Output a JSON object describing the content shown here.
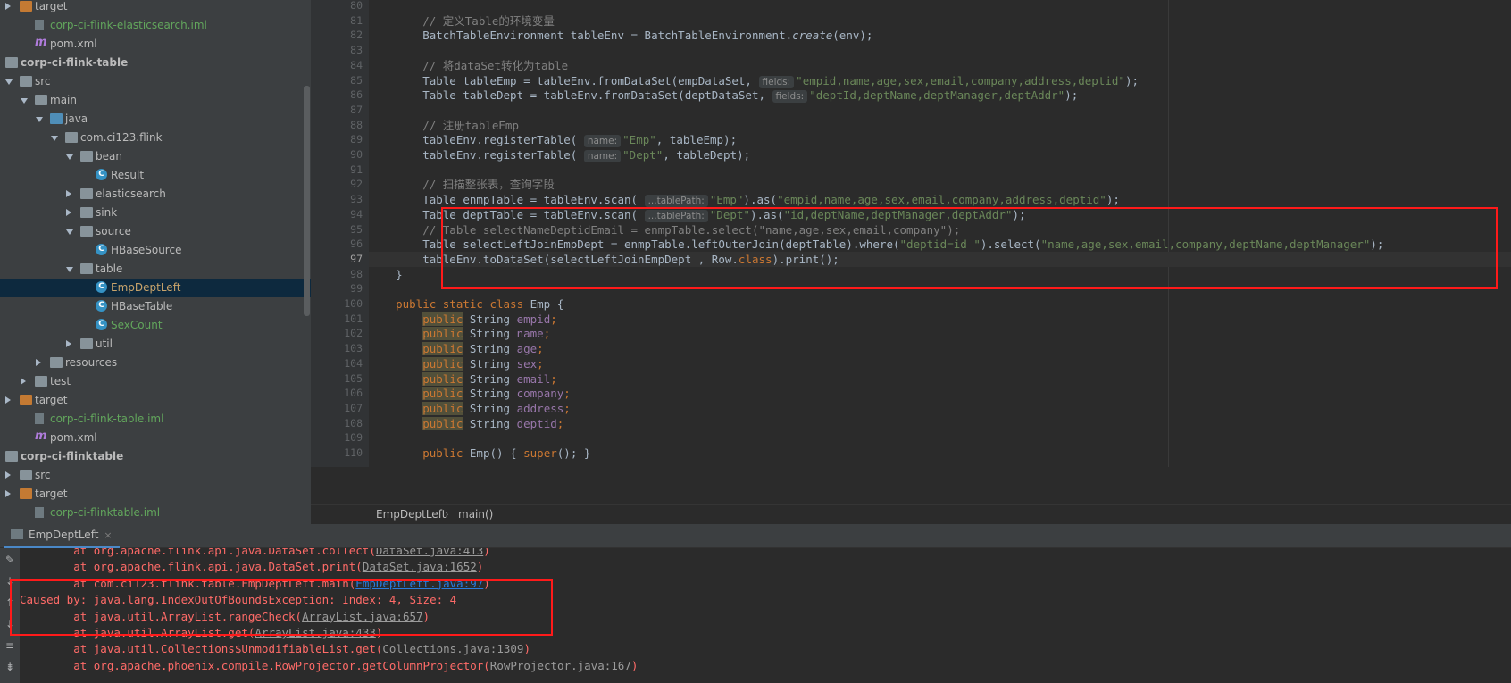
{
  "project_tree": {
    "items": [
      {
        "label": "target",
        "icon": "folder-orange-icon",
        "arrow": "right",
        "indent": 0,
        "style": "normal"
      },
      {
        "label": "corp-ci-flink-elasticsearch.iml",
        "icon": "iml-file-icon",
        "arrow": "",
        "indent": 1,
        "style": "green"
      },
      {
        "label": "pom.xml",
        "icon": "maven-icon",
        "arrow": "",
        "indent": 1,
        "style": "normal"
      },
      {
        "label": "corp-ci-flink-table",
        "icon": "module-icon",
        "arrow": "down",
        "indent": -1,
        "style": "bold"
      },
      {
        "label": "src",
        "icon": "folder-icon",
        "arrow": "down",
        "indent": 0,
        "style": "normal"
      },
      {
        "label": "main",
        "icon": "folder-icon",
        "arrow": "down",
        "indent": 1,
        "style": "normal"
      },
      {
        "label": "java",
        "icon": "folder-blue-icon",
        "arrow": "down",
        "indent": 2,
        "style": "normal"
      },
      {
        "label": "com.ci123.flink",
        "icon": "package-icon",
        "arrow": "down",
        "indent": 3,
        "style": "normal"
      },
      {
        "label": "bean",
        "icon": "package-icon",
        "arrow": "down",
        "indent": 4,
        "style": "normal"
      },
      {
        "label": "Result",
        "icon": "class-icon",
        "arrow": "",
        "indent": 5,
        "style": "normal"
      },
      {
        "label": "elasticsearch",
        "icon": "package-icon",
        "arrow": "right",
        "indent": 4,
        "style": "normal"
      },
      {
        "label": "sink",
        "icon": "package-icon",
        "arrow": "right",
        "indent": 4,
        "style": "normal"
      },
      {
        "label": "source",
        "icon": "package-icon",
        "arrow": "down",
        "indent": 4,
        "style": "normal"
      },
      {
        "label": "HBaseSource",
        "icon": "class-icon",
        "arrow": "",
        "indent": 5,
        "style": "normal"
      },
      {
        "label": "table",
        "icon": "package-icon",
        "arrow": "down",
        "indent": 4,
        "style": "normal"
      },
      {
        "label": "EmpDeptLeft",
        "icon": "class-icon",
        "arrow": "",
        "indent": 5,
        "style": "orange",
        "selected": true
      },
      {
        "label": "HBaseTable",
        "icon": "class-icon",
        "arrow": "",
        "indent": 5,
        "style": "normal"
      },
      {
        "label": "SexCount",
        "icon": "class-icon",
        "arrow": "",
        "indent": 5,
        "style": "green"
      },
      {
        "label": "util",
        "icon": "package-icon",
        "arrow": "right",
        "indent": 4,
        "style": "normal"
      },
      {
        "label": "resources",
        "icon": "folder-icon",
        "arrow": "right",
        "indent": 2,
        "style": "normal"
      },
      {
        "label": "test",
        "icon": "folder-icon",
        "arrow": "right",
        "indent": 1,
        "style": "normal"
      },
      {
        "label": "target",
        "icon": "folder-orange-icon",
        "arrow": "right",
        "indent": 0,
        "style": "normal"
      },
      {
        "label": "corp-ci-flink-table.iml",
        "icon": "iml-file-icon",
        "arrow": "",
        "indent": 1,
        "style": "green"
      },
      {
        "label": "pom.xml",
        "icon": "maven-icon",
        "arrow": "",
        "indent": 1,
        "style": "normal"
      },
      {
        "label": "corp-ci-flinktable",
        "icon": "module-icon",
        "arrow": "down",
        "indent": -1,
        "style": "bold"
      },
      {
        "label": "src",
        "icon": "folder-icon",
        "arrow": "right",
        "indent": 0,
        "style": "normal"
      },
      {
        "label": "target",
        "icon": "folder-orange-icon",
        "arrow": "right",
        "indent": 0,
        "style": "normal"
      },
      {
        "label": "corp-ci-flinktable.iml",
        "icon": "iml-file-icon",
        "arrow": "",
        "indent": 1,
        "style": "green"
      }
    ]
  },
  "editor": {
    "current_line": 97,
    "lines": [
      {
        "n": "80",
        "segs": []
      },
      {
        "n": "81",
        "segs": [
          [
            "cm",
            "        // 定义Table的环境变量"
          ]
        ]
      },
      {
        "n": "82",
        "segs": [
          [
            "",
            "        BatchTableEnvironment tableEnv = BatchTableEnvironment."
          ],
          [
            "it",
            "create"
          ],
          [
            "",
            "(env);"
          ]
        ]
      },
      {
        "n": "83",
        "segs": []
      },
      {
        "n": "84",
        "segs": [
          [
            "cm",
            "        // 将dataSet转化为table"
          ]
        ]
      },
      {
        "n": "85",
        "segs": [
          [
            "",
            "        Table tableEmp = tableEnv.fromDataSet(empDataSet, "
          ],
          [
            "hint",
            "fields:"
          ],
          [
            "str",
            "\"empid,name,age,sex,email,company,address,deptid\""
          ],
          [
            "",
            ");"
          ]
        ]
      },
      {
        "n": "86",
        "segs": [
          [
            "",
            "        Table tableDept = tableEnv.fromDataSet(deptDataSet, "
          ],
          [
            "hint",
            "fields:"
          ],
          [
            "str",
            "\"deptId,deptName,deptManager,deptAddr\""
          ],
          [
            "",
            ");"
          ]
        ]
      },
      {
        "n": "87",
        "segs": []
      },
      {
        "n": "88",
        "segs": [
          [
            "cm",
            "        // 注册tableEmp"
          ]
        ]
      },
      {
        "n": "89",
        "segs": [
          [
            "",
            "        tableEnv.registerTable( "
          ],
          [
            "hint",
            "name:"
          ],
          [
            "str",
            "\"Emp\""
          ],
          [
            "",
            ", tableEmp);"
          ]
        ]
      },
      {
        "n": "90",
        "segs": [
          [
            "",
            "        tableEnv.registerTable( "
          ],
          [
            "hint",
            "name:"
          ],
          [
            "str",
            "\"Dept\""
          ],
          [
            "",
            ", tableDept);"
          ]
        ]
      },
      {
        "n": "91",
        "segs": []
      },
      {
        "n": "92",
        "segs": [
          [
            "cm",
            "        // 扫描整张表，查询字段"
          ]
        ]
      },
      {
        "n": "93",
        "segs": [
          [
            "",
            "        Table enmpTable = tableEnv.scan( "
          ],
          [
            "hint",
            "...tablePath:"
          ],
          [
            "str",
            "\"Emp\""
          ],
          [
            "",
            ").as("
          ],
          [
            "str",
            "\"empid,name,age,sex,email,company,address,deptid\""
          ],
          [
            "",
            ");"
          ]
        ]
      },
      {
        "n": "94",
        "segs": [
          [
            "",
            "        Table deptTable = tableEnv.scan( "
          ],
          [
            "hint",
            "...tablePath:"
          ],
          [
            "str",
            "\"Dept\""
          ],
          [
            "",
            ").as("
          ],
          [
            "str",
            "\"id,deptName,deptManager,deptAddr\""
          ],
          [
            "",
            ");"
          ]
        ]
      },
      {
        "n": "95",
        "segs": [
          [
            "cm",
            "        // Table selectNameDeptidEmail = enmpTable.select(\"name,age,sex,email,company\");"
          ]
        ]
      },
      {
        "n": "96",
        "segs": [
          [
            "",
            "        Table selectLeftJoinEmpDept = enmpTable.leftOuterJoin(deptTable).where("
          ],
          [
            "str",
            "\"deptid=id \""
          ],
          [
            "",
            ").select("
          ],
          [
            "str",
            "\"name,age,sex,email,company,deptName,deptManager\""
          ],
          [
            "",
            ");"
          ]
        ]
      },
      {
        "n": "97",
        "segs": [
          [
            "",
            "        tableEnv.toDataSet(selectLeftJoinEmpDept , Row."
          ],
          [
            "kw",
            "class"
          ],
          [
            "",
            ").print();"
          ]
        ]
      },
      {
        "n": "98",
        "segs": [
          [
            "",
            "    }"
          ]
        ]
      },
      {
        "n": "99",
        "segs": []
      },
      {
        "n": "100",
        "segs": [
          [
            "",
            "    "
          ],
          [
            "kw",
            "public static class "
          ],
          [
            "",
            "Emp {"
          ]
        ]
      },
      {
        "n": "101",
        "segs": [
          [
            "",
            "        "
          ],
          [
            "kwbg",
            "public"
          ],
          [
            "",
            " String "
          ],
          [
            "fld",
            "empid"
          ],
          [
            "kw",
            ";"
          ]
        ]
      },
      {
        "n": "102",
        "segs": [
          [
            "",
            "        "
          ],
          [
            "kwbg",
            "public"
          ],
          [
            "",
            " String "
          ],
          [
            "fld",
            "name"
          ],
          [
            "kw",
            ";"
          ]
        ]
      },
      {
        "n": "103",
        "segs": [
          [
            "",
            "        "
          ],
          [
            "kwbg",
            "public"
          ],
          [
            "",
            " String "
          ],
          [
            "fld",
            "age"
          ],
          [
            "kw",
            ";"
          ]
        ]
      },
      {
        "n": "104",
        "segs": [
          [
            "",
            "        "
          ],
          [
            "kwbg",
            "public"
          ],
          [
            "",
            " String "
          ],
          [
            "fld",
            "sex"
          ],
          [
            "kw",
            ";"
          ]
        ]
      },
      {
        "n": "105",
        "segs": [
          [
            "",
            "        "
          ],
          [
            "kwbg",
            "public"
          ],
          [
            "",
            " String "
          ],
          [
            "fld",
            "email"
          ],
          [
            "kw",
            ";"
          ]
        ]
      },
      {
        "n": "106",
        "segs": [
          [
            "",
            "        "
          ],
          [
            "kwbg",
            "public"
          ],
          [
            "",
            " String "
          ],
          [
            "fld",
            "company"
          ],
          [
            "kw",
            ";"
          ]
        ]
      },
      {
        "n": "107",
        "segs": [
          [
            "",
            "        "
          ],
          [
            "kwbg",
            "public"
          ],
          [
            "",
            " String "
          ],
          [
            "fld",
            "address"
          ],
          [
            "kw",
            ";"
          ]
        ]
      },
      {
        "n": "108",
        "segs": [
          [
            "",
            "        "
          ],
          [
            "kwbg",
            "public"
          ],
          [
            "",
            " String "
          ],
          [
            "fld",
            "deptid"
          ],
          [
            "kw",
            ";"
          ]
        ]
      },
      {
        "n": "109",
        "segs": []
      },
      {
        "n": "110",
        "segs": [
          [
            "",
            "        "
          ],
          [
            "kw",
            "public "
          ],
          [
            "",
            "Emp() { "
          ],
          [
            "kw",
            "super"
          ],
          [
            "",
            "(); }"
          ]
        ]
      }
    ]
  },
  "breadcrumb": {
    "class_name": "EmpDeptLeft",
    "separator": "›",
    "method_name": "main()"
  },
  "run_panel": {
    "tab_label": "EmpDeptLeft",
    "tab_close": "×",
    "lines": [
      [
        [
          "",
          "        at org.apache.flink.api.java.DataSet.collect("
        ],
        [
          "glnk",
          "DataSet.java:413"
        ],
        [
          "",
          ")"
        ]
      ],
      [
        [
          "",
          "        at org.apache.flink.api.java.DataSet.print("
        ],
        [
          "glnk",
          "DataSet.java:1652"
        ],
        [
          "",
          ")"
        ]
      ],
      [
        [
          "",
          "        at com.ci123.flink.table.EmpDeptLeft.main("
        ],
        [
          "lnk",
          "EmpDeptLeft.java:97"
        ],
        [
          "",
          ")"
        ]
      ],
      [
        [
          "",
          "Caused by: java.lang.IndexOutOfBoundsException: Index: 4, Size: 4"
        ]
      ],
      [
        [
          "",
          "        at java.util.ArrayList.rangeCheck("
        ],
        [
          "glnk",
          "ArrayList.java:657"
        ],
        [
          "",
          ")"
        ]
      ],
      [
        [
          "",
          "        at java.util.ArrayList.get("
        ],
        [
          "glnk",
          "ArrayList.java:433"
        ],
        [
          "",
          ")"
        ]
      ],
      [
        [
          "",
          "        at java.util.Collections$UnmodifiableList.get("
        ],
        [
          "glnk",
          "Collections.java:1309"
        ],
        [
          "",
          ")"
        ]
      ],
      [
        [
          "",
          "        at org.apache.phoenix.compile.RowProjector.getColumnProjector("
        ],
        [
          "glnk",
          "RowProjector.java:167"
        ],
        [
          "",
          ")"
        ]
      ]
    ]
  }
}
